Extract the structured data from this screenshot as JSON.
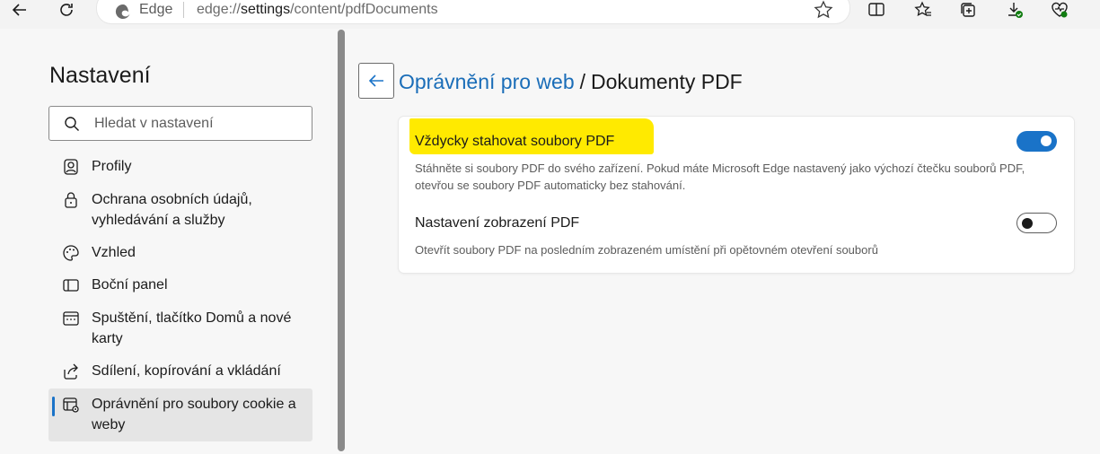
{
  "browser": {
    "name": "Edge",
    "url_prefix": "edge://",
    "url_host": "settings",
    "url_path": "/content/pdfDocuments"
  },
  "sidebar": {
    "title": "Nastavení",
    "search_placeholder": "Hledat v nastavení",
    "items": [
      {
        "label": "Profily",
        "icon": "profile-icon"
      },
      {
        "label": "Ochrana osobních údajů, vyhledávání a služby",
        "icon": "lock-icon"
      },
      {
        "label": "Vzhled",
        "icon": "palette-icon"
      },
      {
        "label": "Boční panel",
        "icon": "sidebar-panel-icon"
      },
      {
        "label": "Spuštění, tlačítko Domů a nové karty",
        "icon": "home-tabs-icon"
      },
      {
        "label": "Sdílení, kopírování a vkládání",
        "icon": "share-icon"
      },
      {
        "label": "Oprávnění pro soubory cookie a weby",
        "icon": "site-permissions-icon",
        "active": true
      }
    ]
  },
  "content": {
    "breadcrumb_parent": "Oprávnění pro web",
    "breadcrumb_separator": "/",
    "breadcrumb_current": "Dokumenty PDF",
    "settings": [
      {
        "title": "Vždycky stahovat soubory PDF",
        "description": "Stáhněte si soubory PDF do svého zařízení. Pokud máte Microsoft Edge nastavený jako výchozí čtečku souborů PDF, otevřou se soubory PDF automaticky bez stahování.",
        "enabled": true,
        "highlighted": true
      },
      {
        "title": "Nastavení zobrazení PDF",
        "description": "Otevřít soubory PDF na posledním zobrazeném umístění při opětovném otevření souborů",
        "enabled": false
      }
    ]
  },
  "colors": {
    "accent": "#1a73c8",
    "highlight": "#ffea00",
    "link": "#1a6db8"
  }
}
